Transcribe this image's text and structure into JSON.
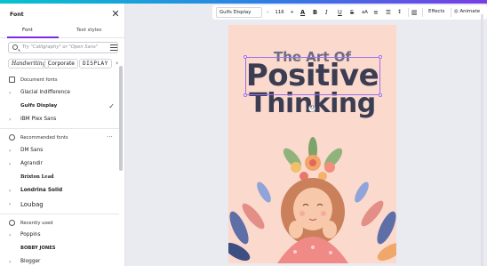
{
  "panel": {
    "title": "Font",
    "tabs": [
      "Font",
      "Text styles"
    ],
    "search_placeholder": "Try \"Calligraphy\" or \"Open Sans\"",
    "chips": [
      "Handwriting",
      "Corporate",
      "DISPLAY"
    ],
    "document_fonts_label": "Document fonts",
    "document_fonts": [
      {
        "name": "Glacial Indifference",
        "expandable": true,
        "selected": false
      },
      {
        "name": "Gulfs Display",
        "expandable": false,
        "selected": true
      },
      {
        "name": "IBM Plex Sans",
        "expandable": true,
        "selected": false
      }
    ],
    "recommended_label": "Recommended fonts",
    "recommended_fonts": [
      {
        "name": "DM Sans",
        "expandable": true
      },
      {
        "name": "Agrandir",
        "expandable": true
      },
      {
        "name": "Brixton Lead",
        "expandable": false
      },
      {
        "name": "Londrina Solid",
        "expandable": true
      },
      {
        "name": "Loubag",
        "expandable": true
      }
    ],
    "recent_label": "Recently used",
    "recent_fonts": [
      {
        "name": "Poppins",
        "expandable": true
      },
      {
        "name": "BOBBY JONES",
        "expandable": false
      },
      {
        "name": "Blogger",
        "expandable": true
      }
    ]
  },
  "toolbar": {
    "font": "Gulfs Display",
    "size": "116",
    "bold": "B",
    "italic": "I",
    "underline": "U",
    "strike": "S",
    "case": "aA",
    "effects": "Effects",
    "animate": "Animate"
  },
  "canvas": {
    "line1": "The Art Of",
    "line2": "Positive",
    "line3": "Thinking",
    "background_color": "#fbd9cd",
    "title_color": "#3b3d52",
    "accent_color": "#7d2ae8"
  }
}
